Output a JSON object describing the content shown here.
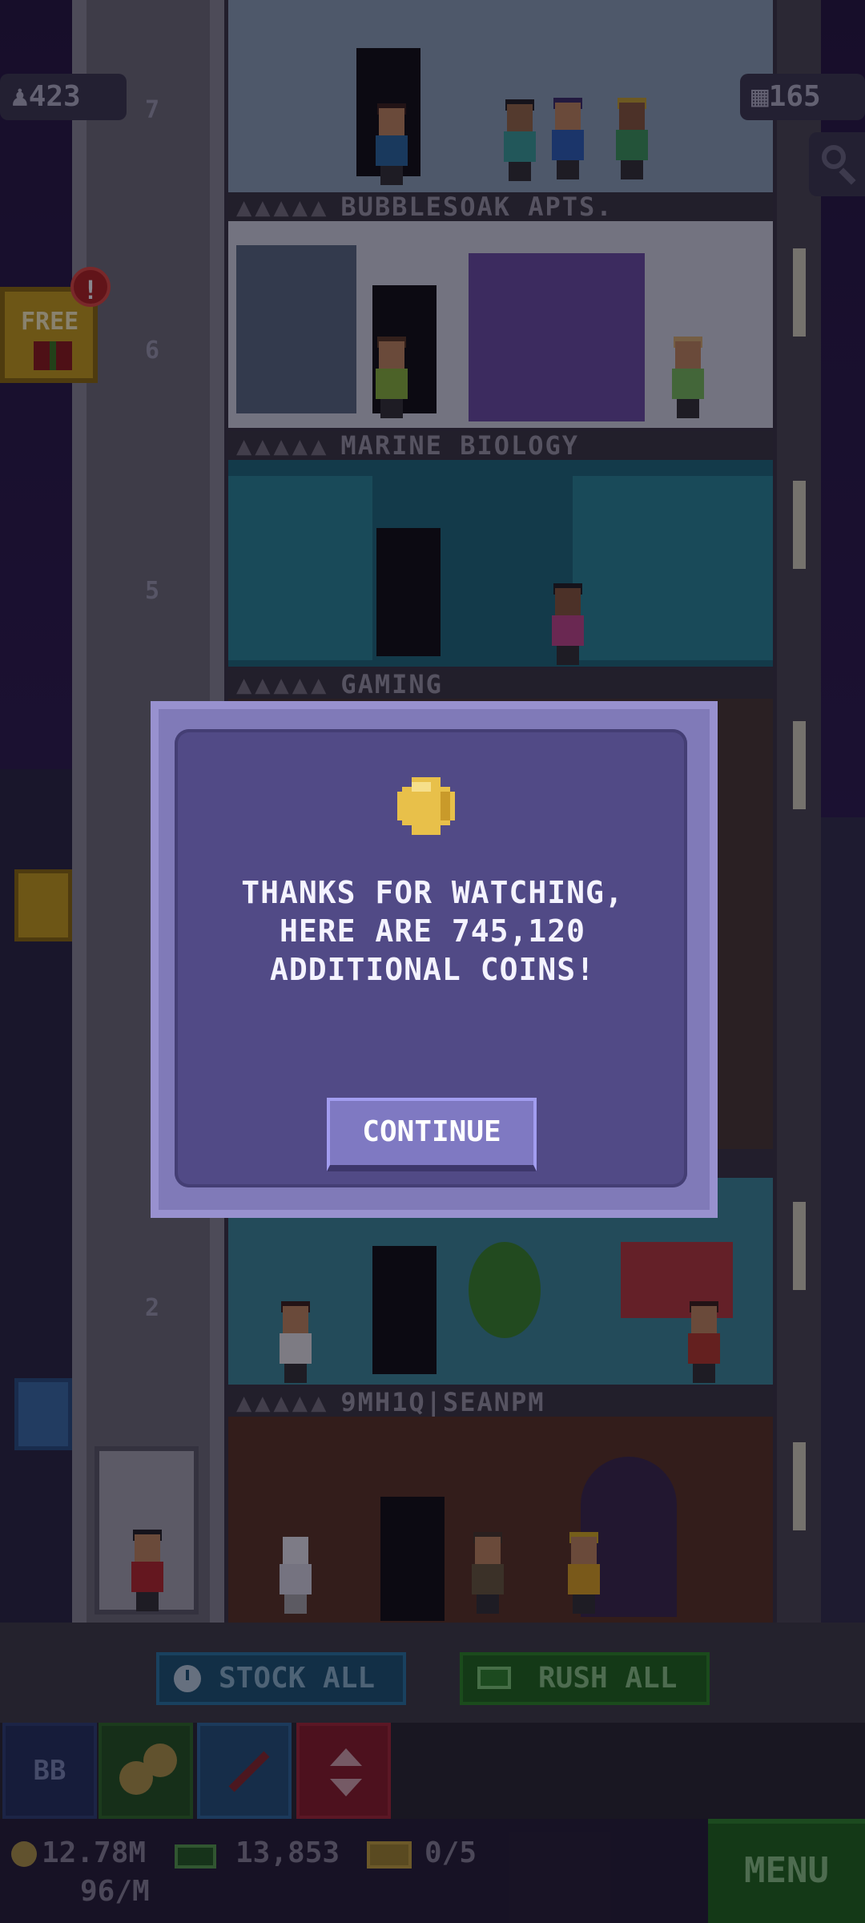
{
  "hud": {
    "population": "423",
    "floors": "165",
    "free_label": "FREE",
    "alert_count": "!"
  },
  "elevator": {
    "floor_numbers": [
      "7",
      "6",
      "5",
      "2"
    ]
  },
  "floors": [
    {
      "label": "BUBBLESOAK APTS."
    },
    {
      "label": "MARINE BIOLOGY"
    },
    {
      "label": "GAMING"
    },
    {
      "label": "9MH1Q|SEANPM"
    }
  ],
  "dialog": {
    "message": "THANKS FOR WATCHING,\nHERE ARE 745,120\nADDITIONAL COINS!",
    "continue_label": "CONTINUE"
  },
  "actions": {
    "stock_all": "STOCK ALL",
    "rush_all": "RUSH ALL"
  },
  "toolbar": {
    "bb_label": "BB"
  },
  "status": {
    "coins": "12.78M",
    "rate": "96/M",
    "bux": "13,853",
    "tickets": "0/5",
    "menu": "MENU"
  }
}
